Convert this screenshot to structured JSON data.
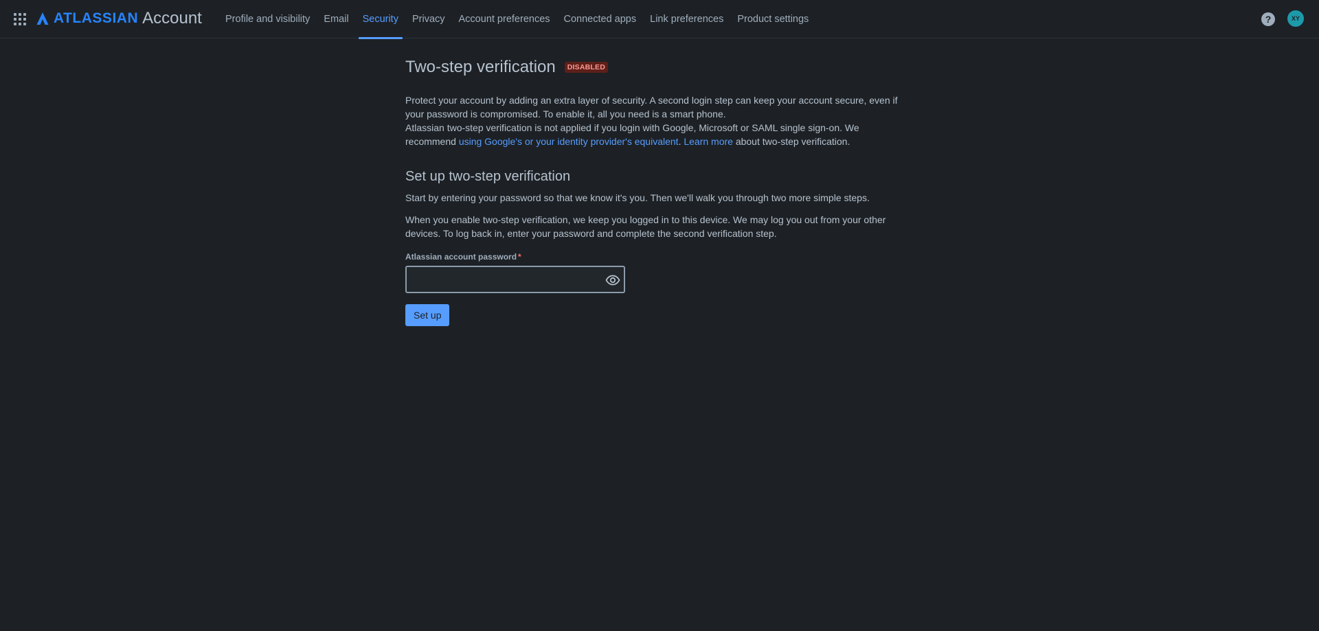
{
  "header": {
    "logo_brand": "ATLASSIAN",
    "logo_product": "Account",
    "brand_color": "#2684ff",
    "icons": {
      "app_switcher": "grid-icon",
      "help": "question-icon"
    },
    "help_glyph": "?",
    "avatar_initials": "XY",
    "avatar_color": "#1d9aaa",
    "tabs": [
      {
        "label": "Profile and visibility",
        "active": false
      },
      {
        "label": "Email",
        "active": false
      },
      {
        "label": "Security",
        "active": true
      },
      {
        "label": "Privacy",
        "active": false
      },
      {
        "label": "Account preferences",
        "active": false
      },
      {
        "label": "Connected apps",
        "active": false
      },
      {
        "label": "Link preferences",
        "active": false
      },
      {
        "label": "Product settings",
        "active": false
      }
    ]
  },
  "main": {
    "title": "Two-step verification",
    "status_badge": "DISABLED",
    "intro": {
      "p1": "Protect your account by adding an extra layer of security. A second login step can keep your account secure, even if your password is compromised. To enable it, all you need is a smart phone.",
      "p2_before": "Atlassian two-step verification is not applied if you login with Google, Microsoft or SAML single sign-on. We recommend ",
      "p2_link1": "using Google's or your identity provider's equivalent",
      "p2_middle": ". ",
      "p2_link2": "Learn more",
      "p2_after": " about two-step verification."
    },
    "setup": {
      "title": "Set up two-step verification",
      "para1": "Start by entering your password so that we know it's you. Then we'll walk you through two more simple steps.",
      "para2": "When you enable two-step verification, we keep you logged in to this device. We may log you out from your other devices. To log back in, enter your password and complete the second verification step.",
      "password_label": "Atlassian account password",
      "required_mark": "*",
      "password_value": "",
      "reveal_icon": "eye-icon",
      "button_label": "Set up"
    }
  }
}
